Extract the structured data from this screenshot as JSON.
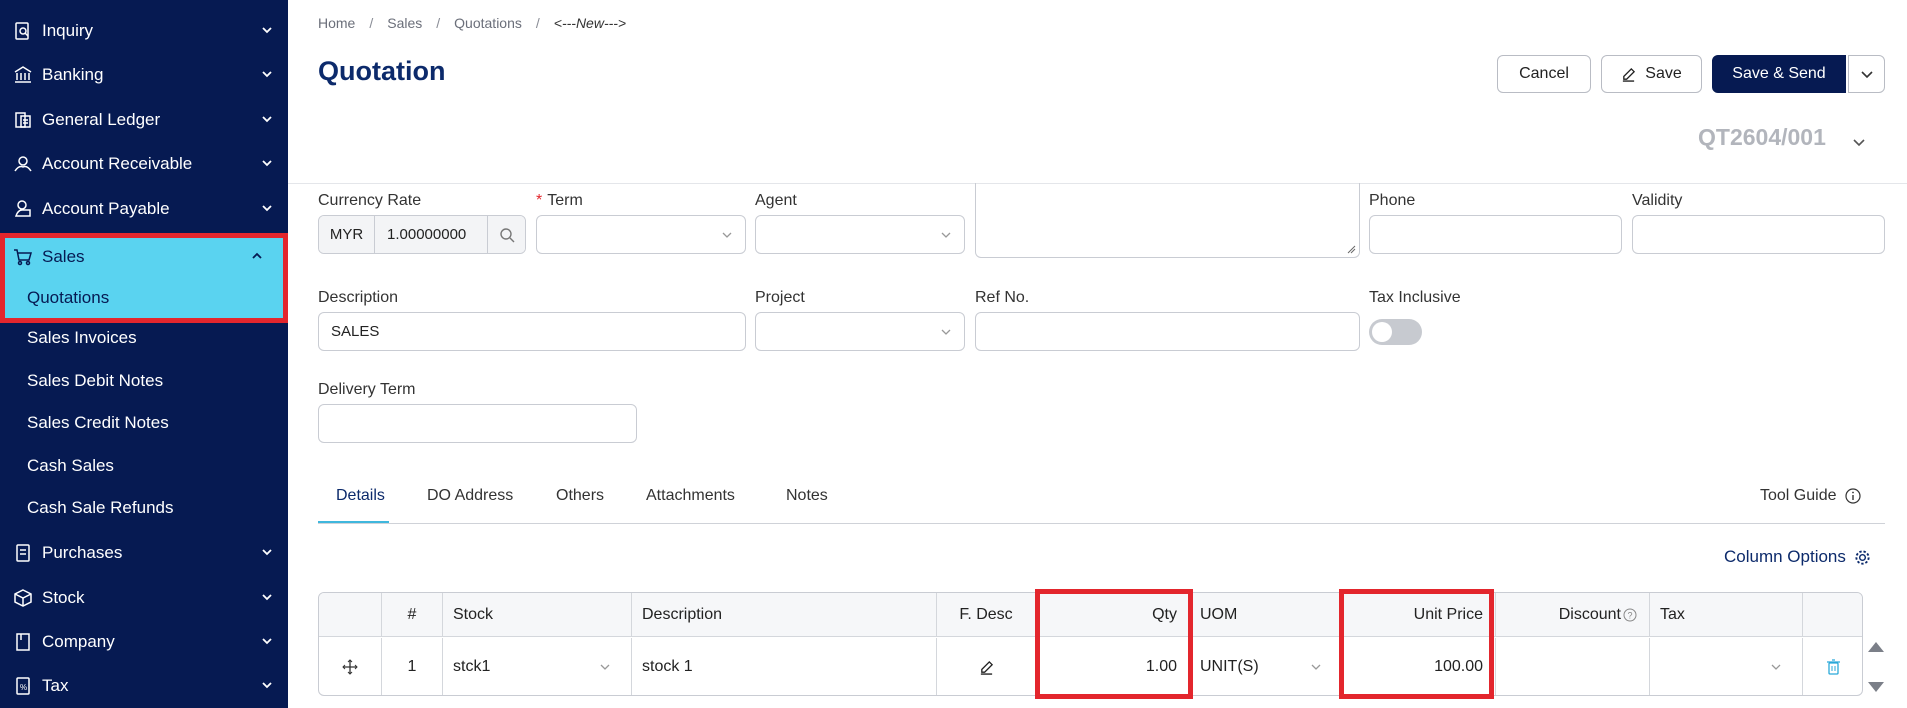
{
  "sidebar": {
    "items": [
      {
        "label": "Inquiry",
        "icon": "inquiry-icon"
      },
      {
        "label": "Banking",
        "icon": "bank-icon"
      },
      {
        "label": "General Ledger",
        "icon": "ledger-icon"
      },
      {
        "label": "Account Receivable",
        "icon": "receivable-icon"
      },
      {
        "label": "Account Payable",
        "icon": "payable-icon"
      },
      {
        "label": "Sales",
        "icon": "cart-icon",
        "expanded": true
      },
      {
        "label": "Purchases",
        "icon": "purchases-icon"
      },
      {
        "label": "Stock",
        "icon": "box-icon"
      },
      {
        "label": "Company",
        "icon": "company-icon"
      },
      {
        "label": "Tax",
        "icon": "tax-icon"
      }
    ],
    "sales_sub": [
      "Quotations",
      "Sales Invoices",
      "Sales Debit Notes",
      "Sales Credit Notes",
      "Cash Sales",
      "Cash Sale Refunds"
    ],
    "active_sub": "Quotations"
  },
  "breadcrumb": [
    "Home",
    "Sales",
    "Quotations",
    "<---New--->"
  ],
  "page": {
    "title": "Quotation",
    "doc_no": "QT2604/001"
  },
  "actions": {
    "cancel": "Cancel",
    "save": "Save",
    "save_send": "Save & Send"
  },
  "form": {
    "currency_rate_label": "Currency Rate",
    "currency_code": "MYR",
    "currency_value": "1.00000000",
    "term_label": "Term",
    "agent_label": "Agent",
    "phone_label": "Phone",
    "validity_label": "Validity",
    "description_label": "Description",
    "description_value": "SALES",
    "project_label": "Project",
    "ref_no_label": "Ref No.",
    "tax_inclusive_label": "Tax Inclusive",
    "tax_inclusive": false,
    "delivery_term_label": "Delivery Term"
  },
  "tabs": [
    "Details",
    "DO Address",
    "Others",
    "Attachments",
    "Notes"
  ],
  "active_tab": "Details",
  "tool_guide": "Tool Guide",
  "column_options": "Column Options",
  "table": {
    "headers": [
      "#",
      "Stock",
      "Description",
      "F. Desc",
      "Qty",
      "UOM",
      "Unit Price",
      "Discount",
      "Tax"
    ],
    "rows": [
      {
        "no": "1",
        "stock": "stck1",
        "description": "stock 1",
        "qty": "1.00",
        "uom": "UNIT(S)",
        "unit_price": "100.00",
        "discount": "",
        "tax": ""
      }
    ]
  },
  "colors": {
    "sidebar_bg": "#061a52",
    "highlight": "#e3262d",
    "active_bg": "#5ad3f0",
    "primary": "#061a52"
  }
}
